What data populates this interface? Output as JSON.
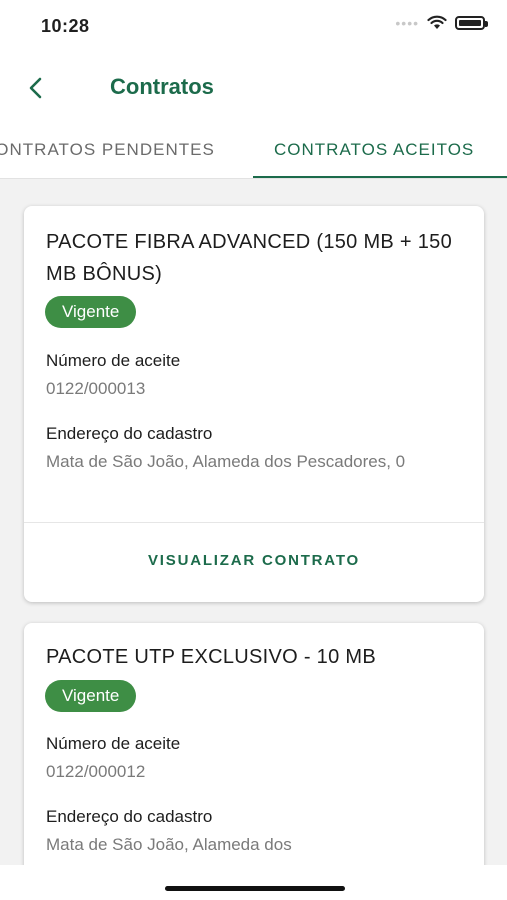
{
  "status": {
    "time": "10:28"
  },
  "header": {
    "title": "Contratos",
    "back_icon": "chevron-left-icon"
  },
  "tabs": [
    {
      "label": "CONTRATOS PENDENTES",
      "active": false
    },
    {
      "label": "CONTRATOS ACEITOS",
      "active": true
    }
  ],
  "contracts": [
    {
      "title": "PACOTE FIBRA ADVANCED (150 MB + 150 MB BÔNUS)",
      "status": "Vigente",
      "acceptance_label": "Número de aceite",
      "acceptance_value": "0122/000013",
      "address_label": "Endereço do cadastro",
      "address_value": "Mata de São João, Alameda dos Pescadores, 0",
      "action": "VISUALIZAR CONTRATO"
    },
    {
      "title": "PACOTE UTP EXCLUSIVO - 10 MB",
      "status": "Vigente",
      "acceptance_label": "Número de aceite",
      "acceptance_value": "0122/000012",
      "address_label": "Endereço do cadastro",
      "address_value": "Mata de São João, Alameda dos"
    }
  ],
  "colors": {
    "accent": "#1c6b4b",
    "badge": "#3e8e45",
    "background": "#f2f2f2"
  }
}
